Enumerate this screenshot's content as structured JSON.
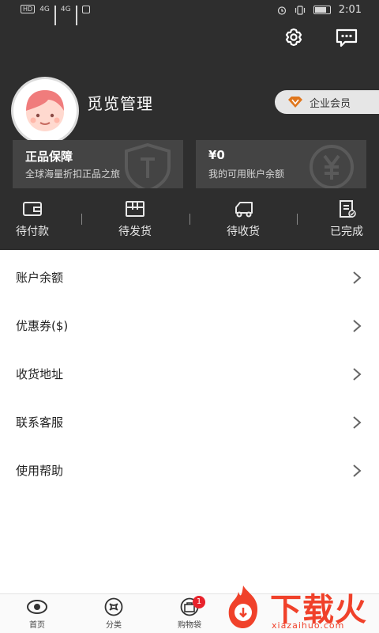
{
  "status_bar": {
    "left_items": [
      "HD",
      "4G",
      "4G"
    ],
    "time": "2:01"
  },
  "header": {
    "settings_icon": "gear-icon",
    "message_icon": "chat-icon"
  },
  "profile": {
    "username": "觅览管理",
    "vip_label": "企业会员"
  },
  "cards": [
    {
      "title": "正品保障",
      "subtitle": "全球海量折扣正品之旅"
    },
    {
      "title": "¥0",
      "subtitle": "我的可用账户余额"
    }
  ],
  "orders": [
    {
      "label": "待付款",
      "icon": "wallet-icon"
    },
    {
      "label": "待发货",
      "icon": "box-icon"
    },
    {
      "label": "待收货",
      "icon": "truck-icon"
    },
    {
      "label": "已完成",
      "icon": "receipt-icon"
    }
  ],
  "menu": [
    {
      "label": "账户余额"
    },
    {
      "label": "优惠券($)"
    },
    {
      "label": "收货地址"
    },
    {
      "label": "联系客服"
    },
    {
      "label": "使用帮助"
    }
  ],
  "tabbar": [
    {
      "label": "首页",
      "icon": "eye-icon"
    },
    {
      "label": "分类",
      "icon": "category-icon"
    },
    {
      "label": "购物袋",
      "icon": "bag-icon",
      "badge": "1"
    }
  ],
  "watermark": {
    "text": "下载火",
    "url": "xiazaihuo.com"
  },
  "colors": {
    "header_bg": "#2e2e2e",
    "card_bg": "#444444",
    "vip_gold": "#e0761c",
    "badge_red": "#e8222b",
    "watermark": "#f0412a"
  }
}
